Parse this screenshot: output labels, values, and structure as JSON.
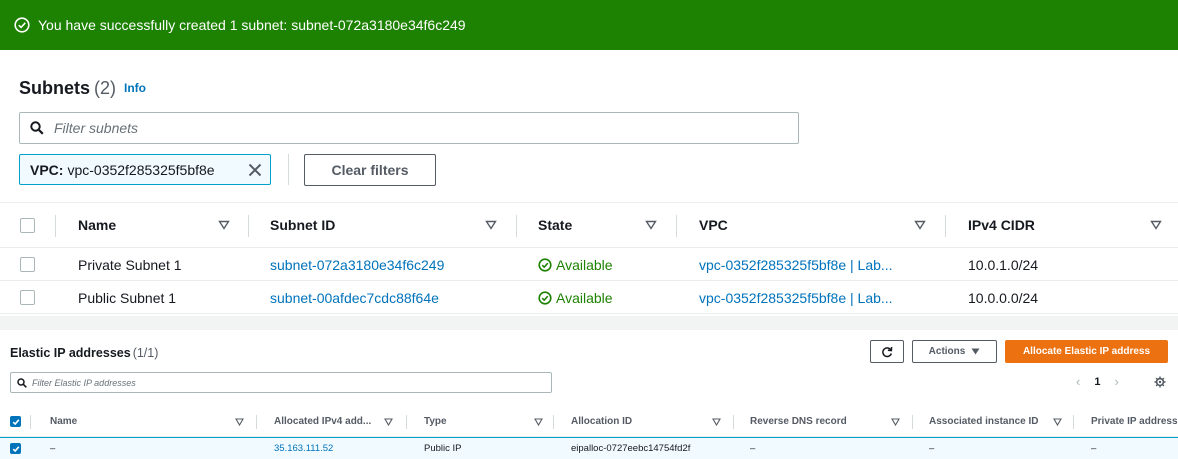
{
  "banner": {
    "message": "You have successfully created 1 subnet: subnet-072a3180e34f6c249",
    "color": "#1d8102"
  },
  "subnets": {
    "title": "Subnets",
    "count": "(2)",
    "info_link": "Info",
    "filter_placeholder": "Filter subnets",
    "token_key": "VPC:",
    "token_value": "vpc-0352f285325f5bf8e",
    "clear_filters_label": "Clear filters",
    "columns": [
      "Name",
      "Subnet ID",
      "State",
      "VPC",
      "IPv4 CIDR"
    ],
    "rows": [
      {
        "name": "Private Subnet 1",
        "subnet_id": "subnet-072a3180e34f6c249",
        "state": "Available",
        "vpc": "vpc-0352f285325f5bf8e | Lab...",
        "cidr": "10.0.1.0/24"
      },
      {
        "name": "Public Subnet 1",
        "subnet_id": "subnet-00afdec7cdc88f64e",
        "state": "Available",
        "vpc": "vpc-0352f285325f5bf8e | Lab...",
        "cidr": "10.0.0.0/24"
      }
    ]
  },
  "elastic_ips": {
    "title": "Elastic IP addresses",
    "count": "(1/1)",
    "actions_label": "Actions",
    "allocate_label": "Allocate Elastic IP address",
    "filter_placeholder": "Filter Elastic IP addresses",
    "page_prev": "‹",
    "page_number": "1",
    "page_next": "›",
    "columns": [
      "Name",
      "Allocated IPv4 add...",
      "Type",
      "Allocation ID",
      "Reverse DNS record",
      "Associated instance ID",
      "Private IP address"
    ],
    "rows": [
      {
        "name": "–",
        "ip": "35.163.111.52",
        "type": "Public IP",
        "allocation_id": "eipalloc-0727eebc14754fd2f",
        "reverse_dns": "–",
        "instance_id": "–",
        "private_ip": "–"
      }
    ]
  },
  "colors": {
    "link": "#0073bb",
    "success": "#1d8102",
    "primary_button": "#ec7211"
  }
}
